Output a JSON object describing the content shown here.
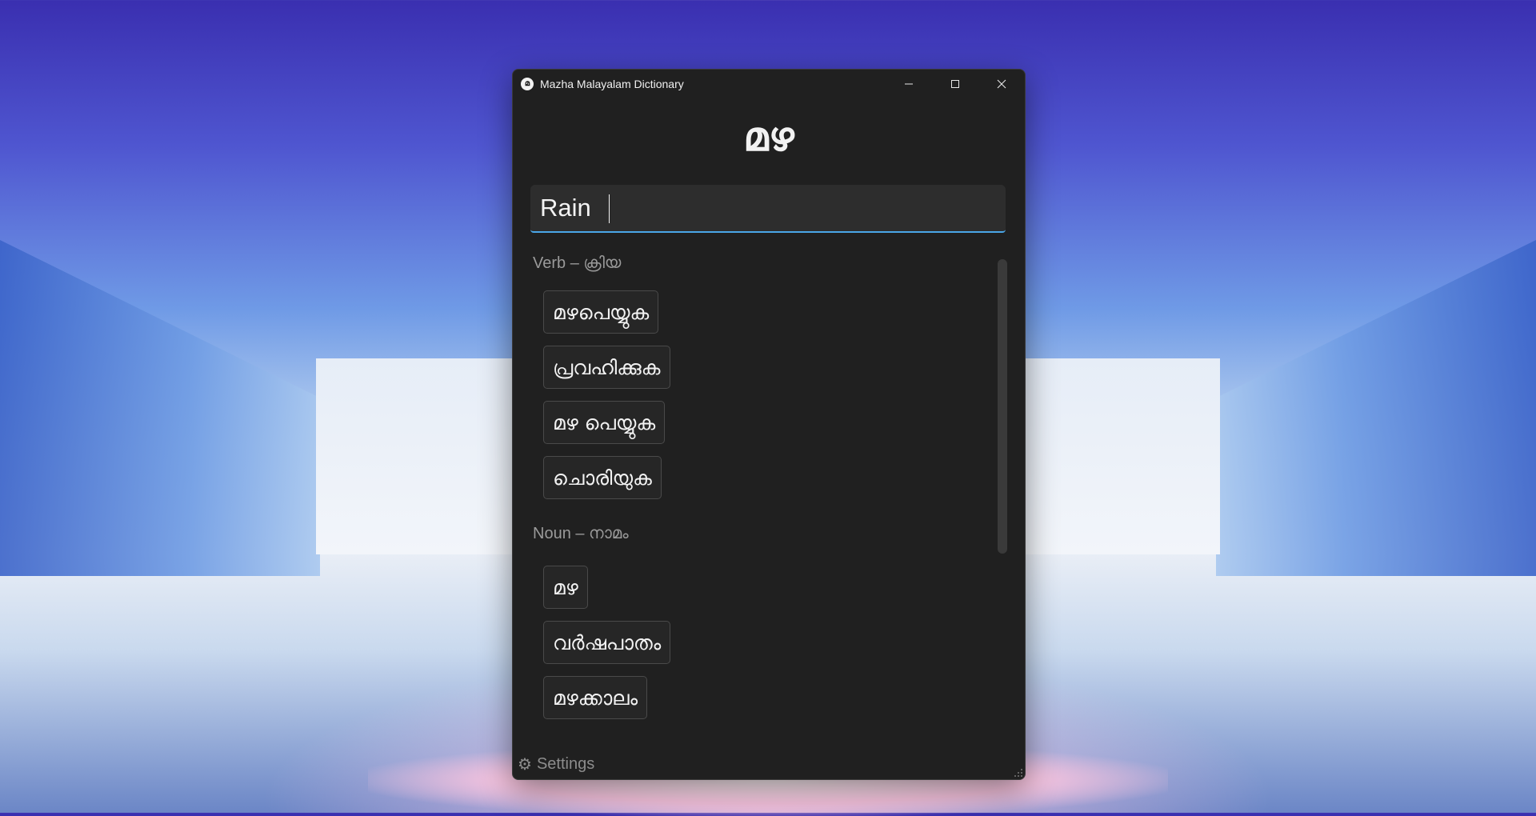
{
  "window": {
    "title": "Mazha Malayalam Dictionary",
    "app_icon_glyph": "മ",
    "minimize_icon": "minimize-icon",
    "maximize_icon": "maximize-icon",
    "close_icon": "close-icon"
  },
  "header": {
    "logo": "മഴ"
  },
  "search": {
    "value": "Rain"
  },
  "results": {
    "verb": {
      "heading": "Verb – ക്രിയ",
      "items": [
        "മഴപെയ്യുക",
        "പ്രവഹിക്കുക",
        "മഴ പെയ്യുക",
        "ചൊരിയുക"
      ]
    },
    "noun": {
      "heading": "Noun – നാമം",
      "items": [
        "മഴ",
        "വർഷപാതം",
        "മഴക്കാലം"
      ]
    }
  },
  "footer": {
    "settings_label": "Settings",
    "settings_icon": "gear-icon"
  },
  "colors": {
    "window_bg": "#202020",
    "accent": "#4aa6e8",
    "chip_border": "#4a4a4a",
    "heading_text": "#9a9a9a"
  }
}
